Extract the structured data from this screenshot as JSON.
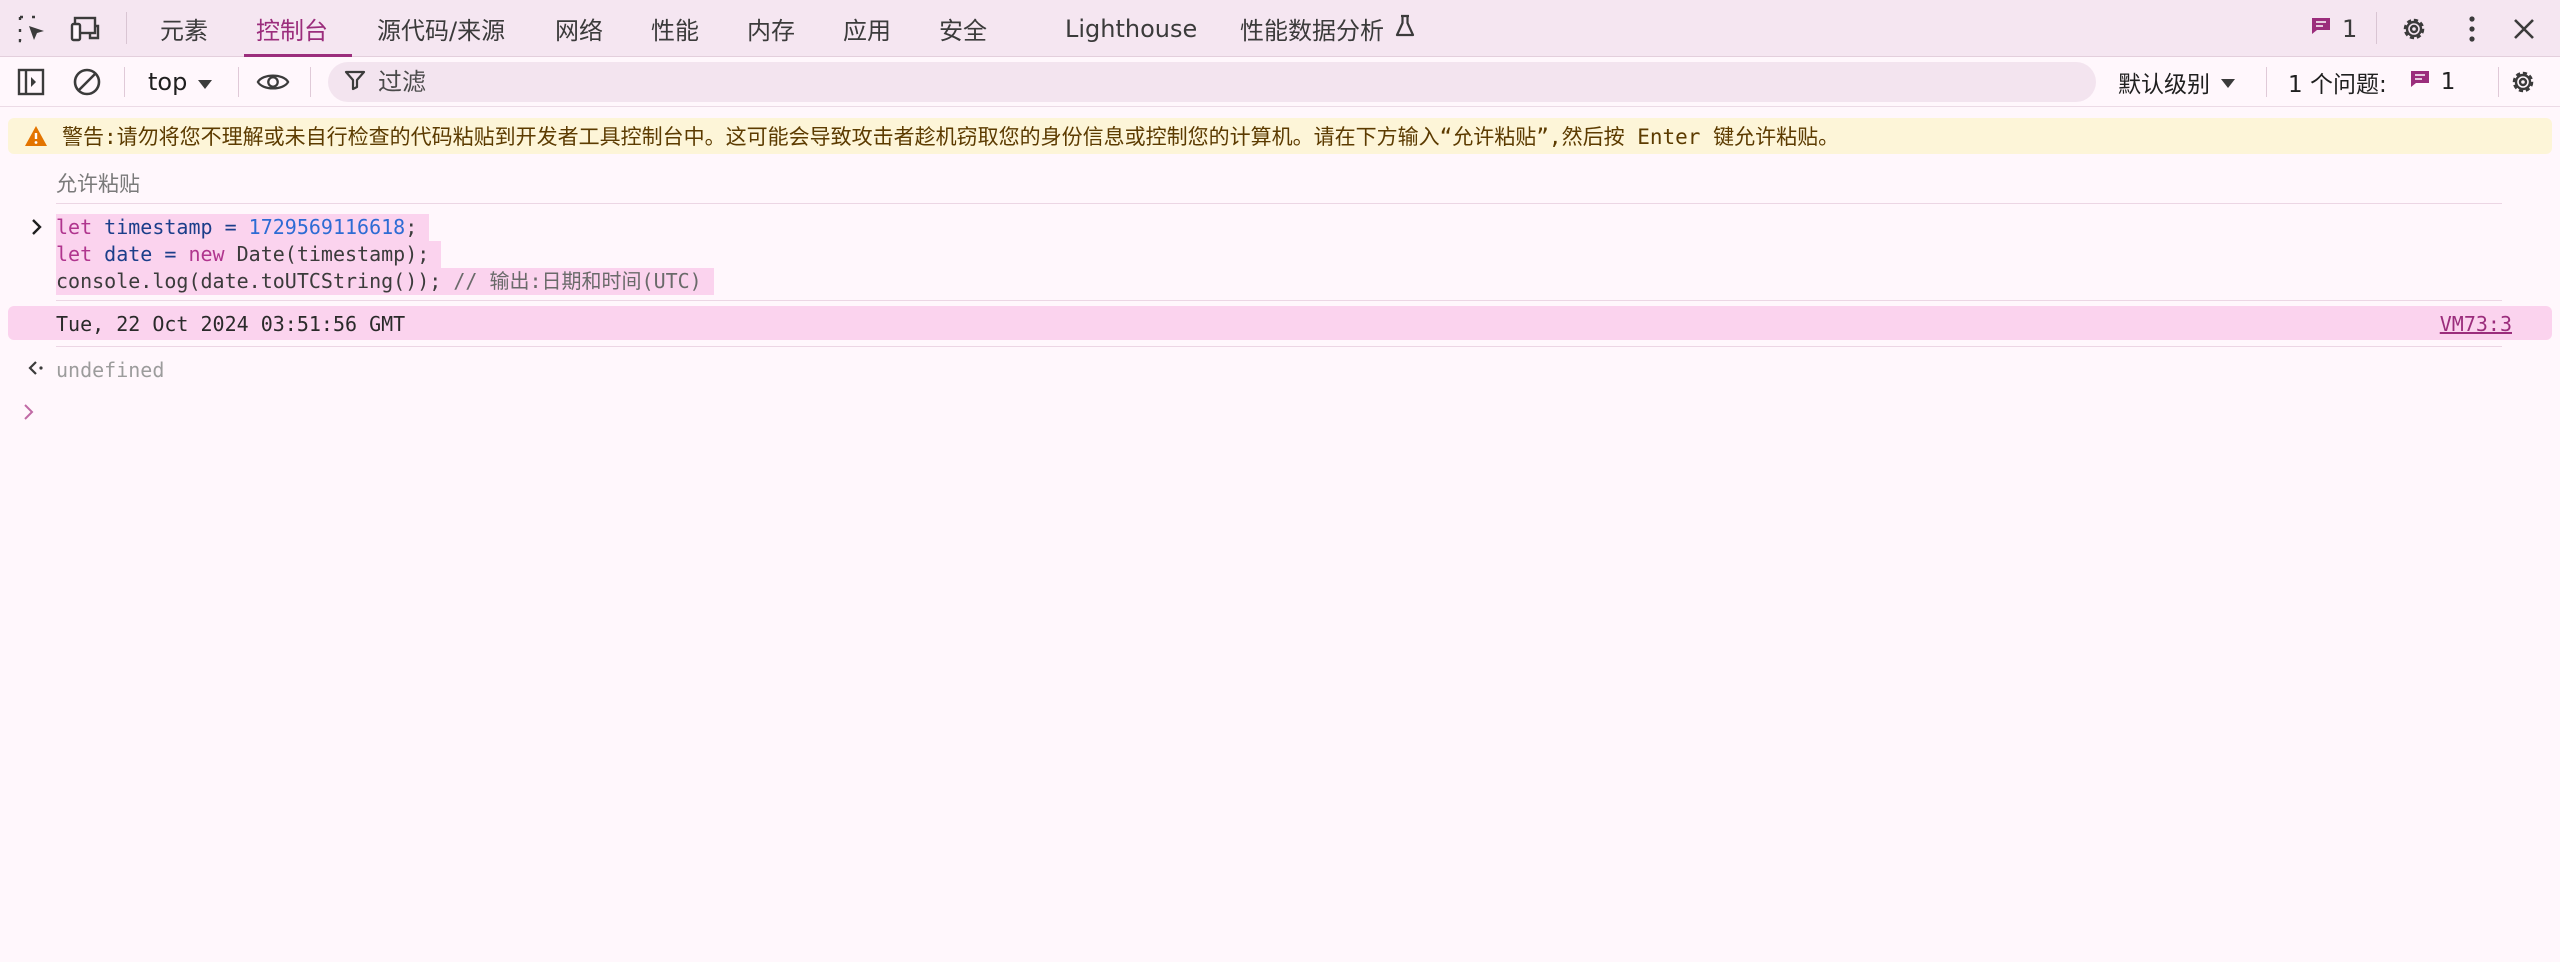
{
  "tabs": [
    {
      "label": "元素"
    },
    {
      "label": "控制台",
      "active": true
    },
    {
      "label": "源代码/来源"
    },
    {
      "label": "网络"
    },
    {
      "label": "性能"
    },
    {
      "label": "内存"
    },
    {
      "label": "应用"
    },
    {
      "label": "安全"
    },
    {
      "label": "Lighthouse"
    },
    {
      "label": "性能数据分析"
    }
  ],
  "issue_count_top": "1",
  "toolbar": {
    "context": "top",
    "filter_placeholder": "过滤",
    "levels": "默认级别",
    "issues_label": "1 个问题:",
    "issues_count": "1"
  },
  "console": {
    "warning": "警告:请勿将您不理解或未自行检查的代码粘贴到开发者工具控制台中。这可能会导致攻击者趁机窃取您的身份信息或控制您的计算机。请在下方输入“允许粘贴”,然后按 Enter 键允许粘贴。",
    "allow_paste": "允许粘贴",
    "input": {
      "l1_kw": "let",
      "l1_ident": " timestamp = ",
      "l1_num": "1729569116618",
      "l1_end": ";",
      "l2_kw": "let",
      "l2_ident": " date = ",
      "l2_new": "new",
      "l2_rest": " Date(timestamp);",
      "l3_code": "console.log(date.toUTCString()); ",
      "l3_comment": "// 输出:日期和时间(UTC)"
    },
    "log_message": "Tue, 22 Oct 2024 03:51:56 GMT",
    "log_source": "VM73:3",
    "result": "undefined"
  },
  "colors": {
    "accent": "#9b2d7c",
    "warning_icon": "#e37400",
    "log_highlight": "#fbd3ee"
  }
}
